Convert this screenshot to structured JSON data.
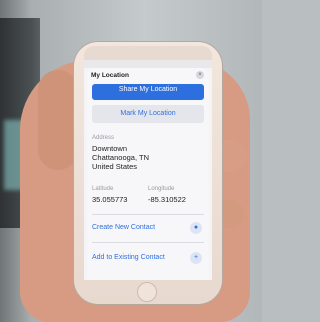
{
  "sheet": {
    "title": "My Location",
    "close_glyph": "×",
    "share_label": "Share My Location",
    "mark_label": "Mark My Location"
  },
  "address": {
    "label": "Address",
    "line1": "Downtown",
    "line2": "Chattanooga, TN",
    "line3": "United States"
  },
  "coords": {
    "latitude_label": "Latitude",
    "latitude": "35.055773",
    "longitude_label": "Longitude",
    "longitude": "-85.310522"
  },
  "actions": {
    "create_contact": "Create New Contact",
    "create_contact_icon": "person-add-icon",
    "add_existing": "Add to Existing Contact",
    "add_existing_icon": "person-plus-icon"
  },
  "colors": {
    "accent": "#2e6fe0"
  }
}
